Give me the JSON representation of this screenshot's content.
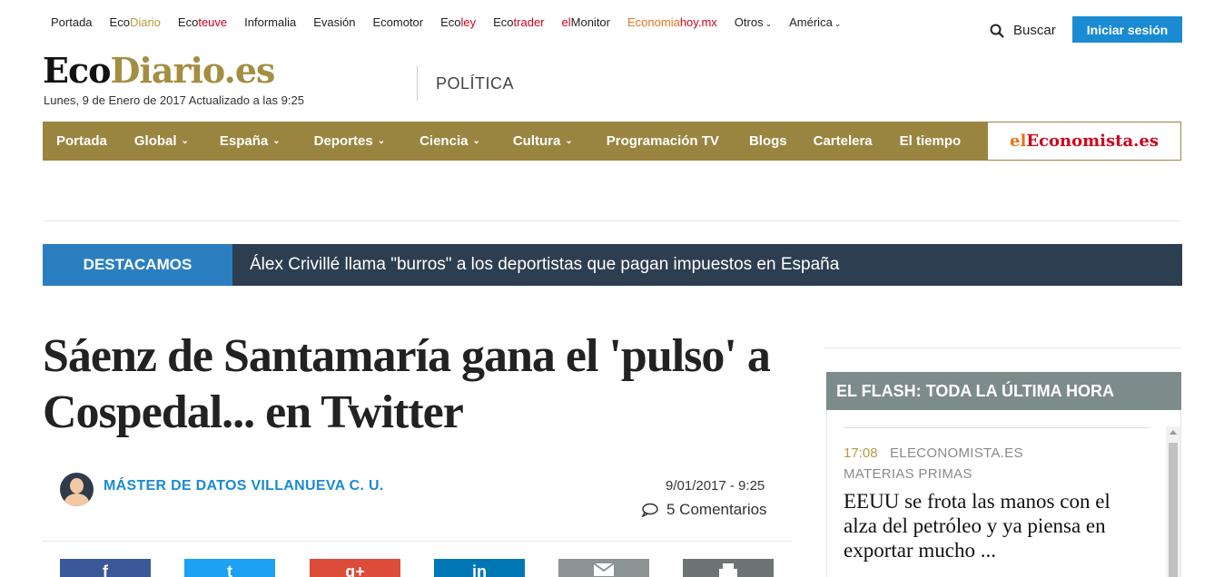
{
  "network": {
    "portada": "Portada",
    "ecodiario_a": "Eco",
    "ecodiario_b": "Diario",
    "ecoteuve_a": "Eco",
    "ecoteuve_b": "teuve",
    "informalia": "Informalia",
    "evasion": "Evasión",
    "ecomotor": "Ecomotor",
    "ecoley_a": "Eco",
    "ecoley_b": "ley",
    "ecotrader_a": "Eco",
    "ecotrader_b": "trader",
    "elmonitor_a": "el",
    "elmonitor_b": "Monitor",
    "economiahoy_a": "Econ",
    "economiahoy_b": "omia",
    "economiahoy_c": "hoy",
    "economiahoy_d": ".mx",
    "otros": "Otros",
    "america": "América"
  },
  "header": {
    "search_label": "Buscar",
    "login_label": "Iniciar sesión",
    "logo_eco": "Eco",
    "logo_diario": "Diario",
    "logo_es": ".es",
    "dateline": "Lunes, 9 de Enero de 2017 Actualizado a las 9:25",
    "section": "POLÍTICA"
  },
  "mainnav": {
    "items": [
      "Portada",
      "Global",
      "España",
      "Deportes",
      "Ciencia",
      "Cultura",
      "Programación TV",
      "Blogs",
      "Cartelera",
      "El tiempo"
    ],
    "brand_el": "el",
    "brand_econ": "Economista",
    "brand_es": ".es"
  },
  "featured": {
    "tag": "DESTACAMOS",
    "headline": "Álex Crivillé llama \"burros\" a los deportistas que pagan impuestos en España"
  },
  "article": {
    "title": "Sáenz de Santamaría gana el 'pulso' a Cospedal... en Twitter",
    "author": "MÁSTER DE DATOS VILLANUEVA C. U.",
    "date": "9/01/2017 - 9:25",
    "comments": "5 Comentarios"
  },
  "share": {
    "facebook": "f",
    "twitter": "t",
    "googleplus": "g+",
    "linkedin": "in"
  },
  "sidebar": {
    "flash_title": "EL FLASH: TODA LA ÚLTIMA HORA",
    "items": [
      {
        "time": "17:08",
        "source": "ELECONOMISTA.ES",
        "category": "MATERIAS PRIMAS",
        "title": "EEUU se frota las manos con el alza del petróleo y ya piensa en exportar mucho ..."
      }
    ]
  },
  "colors": {
    "gold": "#9a8540",
    "blue": "#1a8bd2",
    "dark": "#2d3e50",
    "flash": "#7d8b8b"
  }
}
